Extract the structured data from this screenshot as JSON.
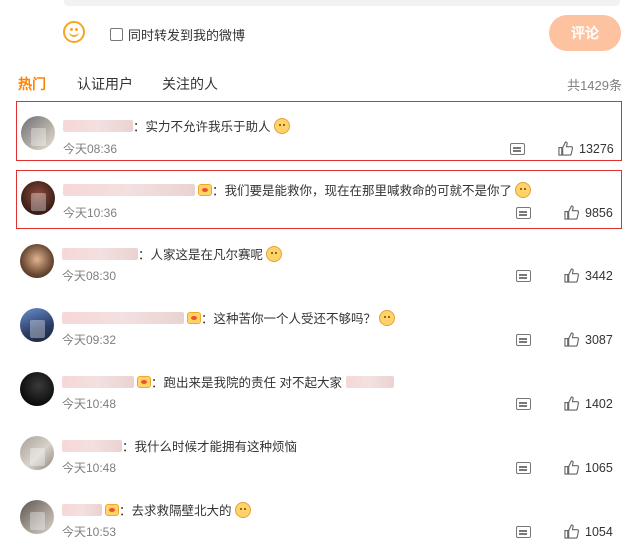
{
  "composer": {
    "emoji_icon": "smile-icon",
    "repost_label": "同时转发到我的微博",
    "submit_label": "评论",
    "submit_color": "#fdc2a0"
  },
  "tabs": {
    "items": [
      "热门",
      "认证用户",
      "关注的人"
    ],
    "active_index": 0,
    "active_color": "#ff8200",
    "total_label": "共1429条"
  },
  "comments": [
    {
      "text": "：实力不允许我乐于助人",
      "time": "今天08:36",
      "likes": "13276",
      "highlighted": true,
      "has_badge": false,
      "emoji": "doge-icon"
    },
    {
      "text": "：我们要是能救你，现在在那里喊救命的可就不是你了",
      "time": "今天10:36",
      "likes": "9856",
      "highlighted": true,
      "has_badge": true,
      "emoji": "doge-icon"
    },
    {
      "text": "：人家这是在凡尔赛呢",
      "time": "今天08:30",
      "likes": "3442",
      "highlighted": false,
      "has_badge": false,
      "emoji": "smile-icon"
    },
    {
      "text": "：这种苦你一个人受还不够吗？",
      "time": "今天09:32",
      "likes": "3087",
      "highlighted": false,
      "has_badge": true,
      "emoji": "doge-icon"
    },
    {
      "text": "：跑出来是我院的责任 对不起大家",
      "time": "今天10:48",
      "likes": "1402",
      "highlighted": false,
      "has_badge": true,
      "emoji": ""
    },
    {
      "text": "：我什么时候才能拥有这种烦恼",
      "time": "今天10:48",
      "likes": "1065",
      "highlighted": false,
      "has_badge": false,
      "emoji": ""
    },
    {
      "text": "：去求救隔壁北大的",
      "time": "今天10:53",
      "likes": "1054",
      "highlighted": false,
      "has_badge": true,
      "emoji": "doge-icon"
    }
  ],
  "colors": {
    "highlight_border": "#e03131",
    "meta_text": "#808080"
  }
}
